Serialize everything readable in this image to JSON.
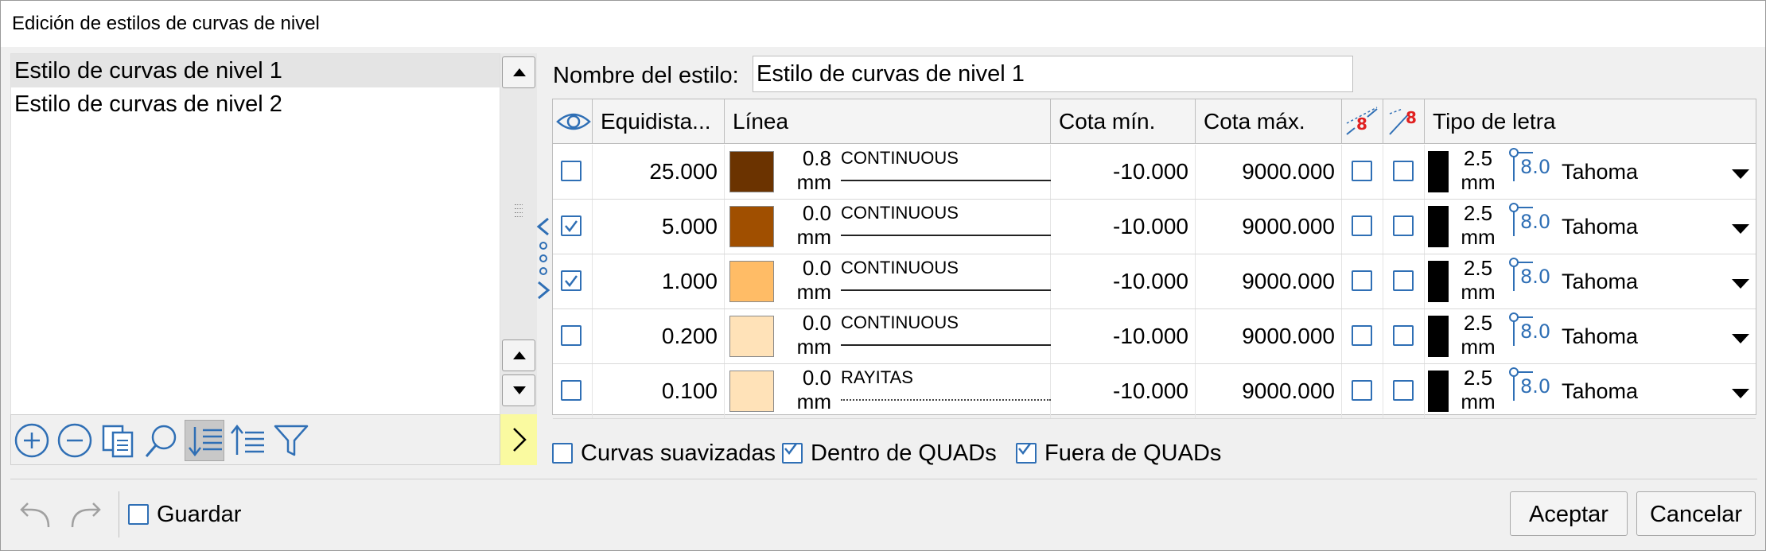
{
  "window": {
    "title": "Edición de estilos de curvas de nivel"
  },
  "styles_list": [
    {
      "label": "Estilo de curvas de nivel 1",
      "selected": true
    },
    {
      "label": "Estilo de curvas de nivel 2",
      "selected": false
    }
  ],
  "list_toolbar": {
    "icons": [
      "add-icon",
      "remove-icon",
      "copy-icon",
      "search-icon",
      "sort-descending-icon",
      "sort-ascending-icon",
      "filter-icon"
    ]
  },
  "style_name": {
    "label": "Nombre del estilo:",
    "value": "Estilo de curvas de nivel 1"
  },
  "grid": {
    "headers": {
      "visible": "eye-icon",
      "interval": "Equidista...",
      "line": "Línea",
      "min": "Cota mín.",
      "max": "Cota máx.",
      "label_break": "label-break-icon",
      "label_along": "label-along-icon",
      "font": "Tipo de letra"
    },
    "rows": [
      {
        "visible": false,
        "interval": "25.000",
        "color": "#6b3300",
        "width": "0.8",
        "unit": "mm",
        "linetype": "CONTINUOUS",
        "dashed": false,
        "min": "-10.000",
        "max": "9000.000",
        "opt1": false,
        "opt2": false,
        "font_size": "2.5",
        "font_unit": "mm",
        "text_height": "8.0",
        "font_name": "Tahoma"
      },
      {
        "visible": true,
        "interval": "5.000",
        "color": "#a04f00",
        "width": "0.0",
        "unit": "mm",
        "linetype": "CONTINUOUS",
        "dashed": false,
        "min": "-10.000",
        "max": "9000.000",
        "opt1": false,
        "opt2": false,
        "font_size": "2.5",
        "font_unit": "mm",
        "text_height": "8.0",
        "font_name": "Tahoma"
      },
      {
        "visible": true,
        "interval": "1.000",
        "color": "#ffbc66",
        "width": "0.0",
        "unit": "mm",
        "linetype": "CONTINUOUS",
        "dashed": false,
        "min": "-10.000",
        "max": "9000.000",
        "opt1": false,
        "opt2": false,
        "font_size": "2.5",
        "font_unit": "mm",
        "text_height": "8.0",
        "font_name": "Tahoma"
      },
      {
        "visible": false,
        "interval": "0.200",
        "color": "#ffe2b8",
        "width": "0.0",
        "unit": "mm",
        "linetype": "CONTINUOUS",
        "dashed": false,
        "min": "-10.000",
        "max": "9000.000",
        "opt1": false,
        "opt2": false,
        "font_size": "2.5",
        "font_unit": "mm",
        "text_height": "8.0",
        "font_name": "Tahoma"
      },
      {
        "visible": false,
        "interval": "0.100",
        "color": "#ffe2b8",
        "width": "0.0",
        "unit": "mm",
        "linetype": "RAYITAS",
        "dashed": true,
        "min": "-10.000",
        "max": "9000.000",
        "opt1": false,
        "opt2": false,
        "font_size": "2.5",
        "font_unit": "mm",
        "text_height": "8.0",
        "font_name": "Tahoma"
      }
    ]
  },
  "options": {
    "smooth": {
      "label": "Curvas suavizadas",
      "checked": false
    },
    "inside": {
      "label": "Dentro de QUADs",
      "checked": true
    },
    "outside": {
      "label": "Fuera de QUADs",
      "checked": true
    }
  },
  "footer": {
    "save": {
      "label": "Guardar",
      "checked": false
    },
    "ok": "Aceptar",
    "cancel": "Cancelar"
  },
  "colors": {
    "accent": "#2f6fb5",
    "warning": "#e02020",
    "expand_button": "#fafaa0"
  }
}
